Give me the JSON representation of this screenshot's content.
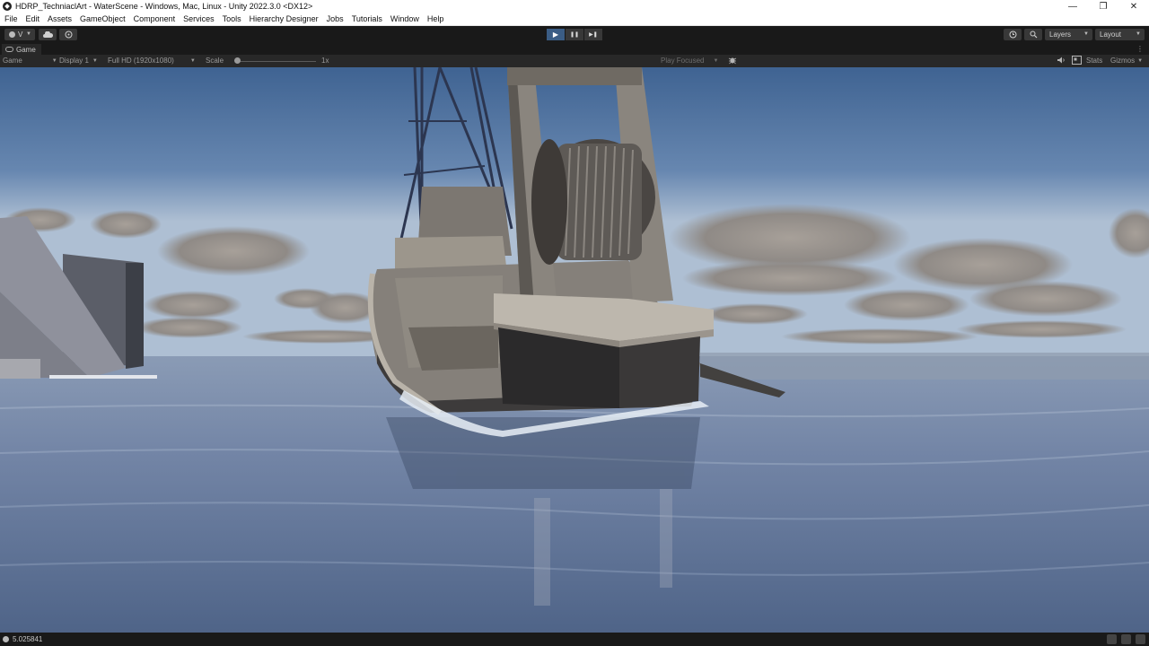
{
  "window": {
    "title": "HDRP_TechniaclArt - WaterScene - Windows, Mac, Linux - Unity 2022.3.0 <DX12>",
    "controls": [
      "—",
      "❐",
      "✕"
    ]
  },
  "menu": [
    "File",
    "Edit",
    "Assets",
    "GameObject",
    "Component",
    "Services",
    "Tools",
    "Hierarchy Designer",
    "Jobs",
    "Tutorials",
    "Window",
    "Help"
  ],
  "toolbar": {
    "account_label": "V",
    "play_icons": [
      "▶",
      "❚❚",
      "▶❚"
    ],
    "layers_label": "Layers",
    "layout_label": "Layout"
  },
  "tab": {
    "label": "Game"
  },
  "game_bar": {
    "mode": "Game",
    "display": "Display 1",
    "resolution": "Full HD (1920x1080)",
    "scale_label": "Scale",
    "scale_value": "1x",
    "play_mode": "Play Focused",
    "stats": "Stats",
    "gizmos": "Gizmos"
  },
  "status": {
    "value": "5.025841"
  },
  "colors": {
    "accent": "#3b5d85",
    "editor_bg": "#191919",
    "panel_bg": "#282828",
    "sky_top": "#4b6d9a",
    "water": "#7d90ad"
  }
}
